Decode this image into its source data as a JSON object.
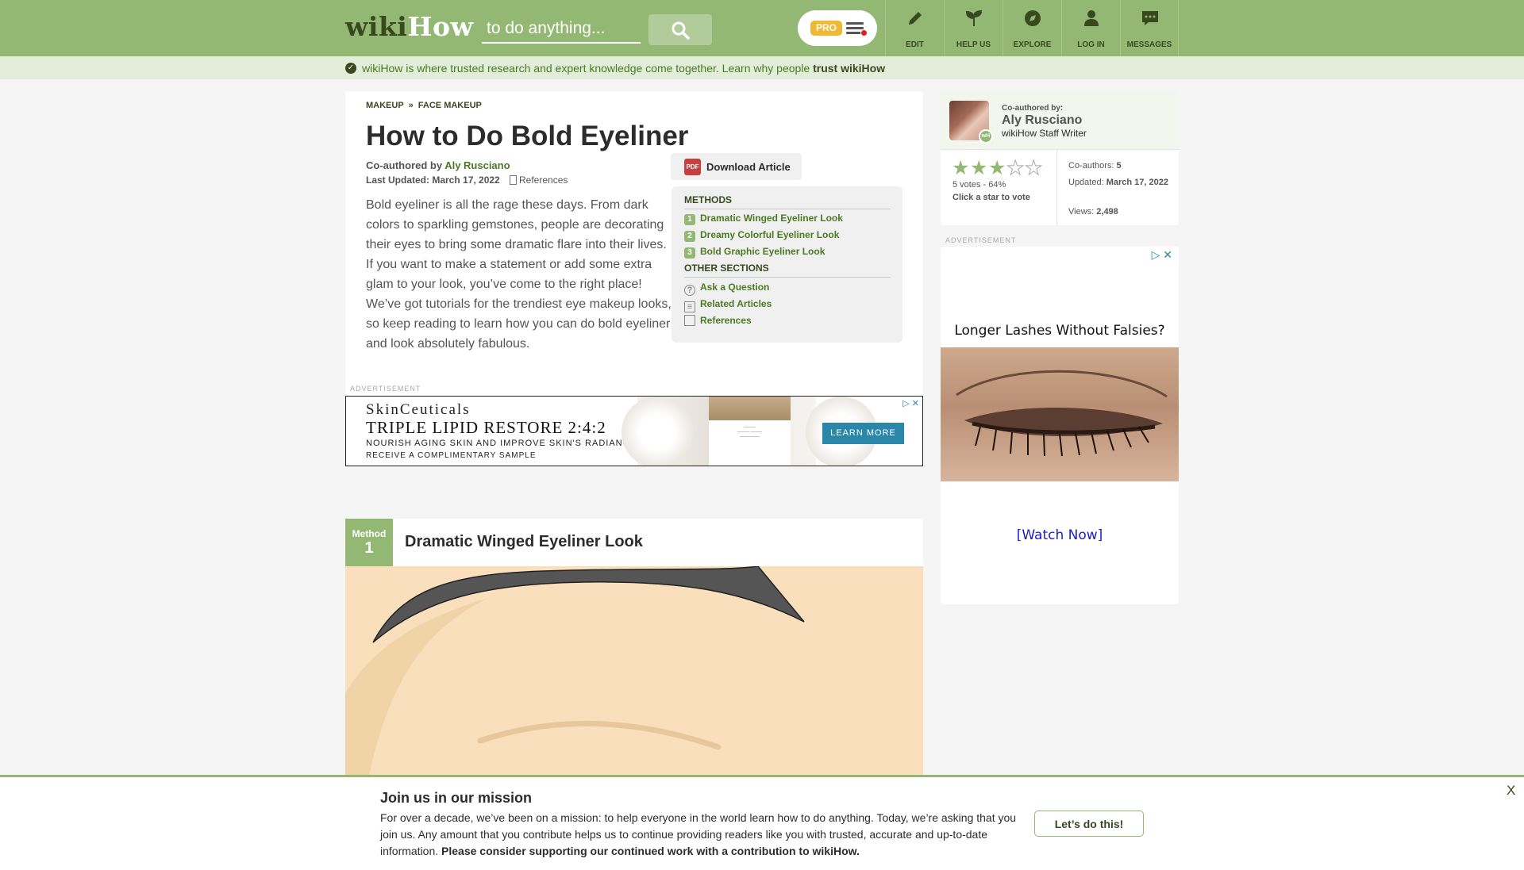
{
  "header": {
    "logo_wiki": "wiki",
    "logo_how": "How",
    "search_placeholder": "to do anything...",
    "pro_badge": "PRO",
    "nav": [
      {
        "label": "EDIT",
        "icon": "pencil-icon"
      },
      {
        "label": "HELP US",
        "icon": "sprout-icon"
      },
      {
        "label": "EXPLORE",
        "icon": "compass-icon"
      },
      {
        "label": "LOG IN",
        "icon": "user-icon"
      },
      {
        "label": "MESSAGES",
        "icon": "chat-icon"
      }
    ]
  },
  "trust_bar": {
    "text": "wikiHow is where trusted research and expert knowledge come together. Learn why people ",
    "link": "trust wikiHow"
  },
  "article": {
    "breadcrumb": [
      "MAKEUP",
      "FACE MAKEUP"
    ],
    "breadcrumb_sep": "»",
    "title": "How to Do Bold Eyeliner",
    "coauthored_prefix": "Co-authored by ",
    "author": "Aly Rusciano",
    "last_updated": "Last Updated: March 17, 2022",
    "references_link": "References",
    "intro": "Bold eyeliner is all the rage these days. From dark colors to sparkling gemstones, people are decorating their eyes to bring some dramatic flare into their lives. If you want to make a statement or add some extra glam to your look, you’ve come to the right place! We’ve got tutorials for the trendiest eye makeup looks, so keep reading to learn how you can do bold eyeliner and look absolutely fabulous.",
    "download_pdf_icon": "PDF",
    "download_label": "Download Article",
    "toc": {
      "methods_heading": "METHODS",
      "methods": [
        {
          "num": "1",
          "label": "Dramatic Winged Eyeliner Look"
        },
        {
          "num": "2",
          "label": "Dreamy Colorful Eyeliner Look"
        },
        {
          "num": "3",
          "label": "Bold Graphic Eyeliner Look"
        }
      ],
      "other_heading": "OTHER SECTIONS",
      "other": [
        {
          "label": "Ask a Question",
          "icon": "question-icon"
        },
        {
          "label": "Related Articles",
          "icon": "document-icon"
        },
        {
          "label": "References",
          "icon": "bookmark-icon"
        }
      ]
    }
  },
  "ads": {
    "label": "ADVERTISEMENT",
    "banner": {
      "brand": "SkinCeuticals",
      "headline": "TRIPLE LIPID RESTORE 2:4:2",
      "sub": "NOURISH AGING SKIN AND IMPROVE SKIN'S RADIANCE",
      "sub2": "RECEIVE A COMPLIMENTARY SAMPLE",
      "cta": "LEARN MORE"
    },
    "side": {
      "title": "Longer Lashes Without Falsies?",
      "cta": "[Watch Now]"
    }
  },
  "method": {
    "tag_label": "Method",
    "number": "1",
    "title": "Dramatic Winged Eyeliner Look"
  },
  "sidebar": {
    "coauthored_by": "Co-authored by:",
    "author": "Aly Rusciano",
    "role": "wikiHow Staff Writer",
    "rating": {
      "filled": 3,
      "total": 5
    },
    "votes": "5 votes - 64%",
    "click_vote": "Click a star to vote",
    "coauthors_label": "Co-authors: ",
    "coauthors_value": "5",
    "updated_label": "Updated: ",
    "updated_value": "March 17, 2022",
    "views_label": "Views: ",
    "views_value": "2,498"
  },
  "donation": {
    "title": "Join us in our mission",
    "text": "For over a decade, we’ve been on a mission: to help everyone in the world learn how to do anything. Today, we’re asking that you join us. Any amount that you contribute helps us to continue providing readers like you with trusted, accurate and up-to-date information. ",
    "bold_text": "Please consider supporting our continued work with a contribution to wikiHow.",
    "button": "Let’s do this!",
    "close": "X"
  },
  "colors": {
    "header_green": "#93b874",
    "dark_green": "#38491f",
    "link_green": "#4b7a23",
    "trust_bg": "#e3eeda",
    "pro_orange": "#f1b833",
    "pdf_red": "#c54141",
    "ad_blue": "#2a87a9"
  }
}
